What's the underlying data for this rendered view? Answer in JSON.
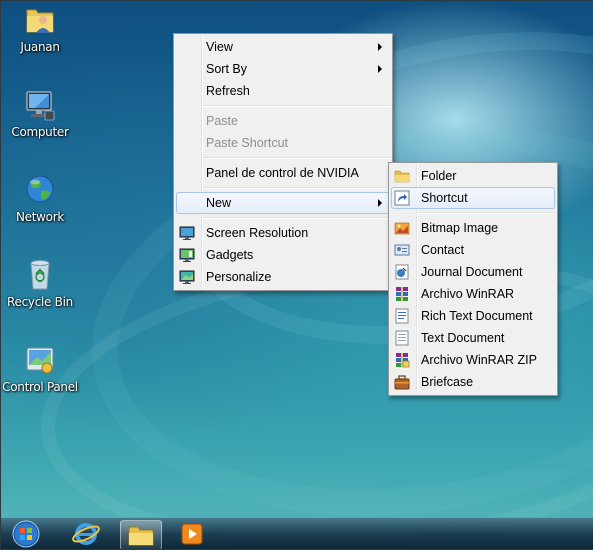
{
  "desktop": {
    "icons": [
      {
        "label": "Juanan",
        "icon": "user-folder-icon"
      },
      {
        "label": "Computer",
        "icon": "computer-icon"
      },
      {
        "label": "Network",
        "icon": "network-globe-icon"
      },
      {
        "label": "Recycle Bin",
        "icon": "recycle-bin-icon"
      },
      {
        "label": "Control Panel",
        "icon": "control-panel-icon"
      }
    ]
  },
  "context_menu": {
    "items": [
      {
        "label": "View",
        "submenu": true
      },
      {
        "label": "Sort By",
        "submenu": true
      },
      {
        "label": "Refresh"
      },
      {
        "label": "Paste",
        "disabled": true
      },
      {
        "label": "Paste Shortcut",
        "disabled": true
      },
      {
        "label": "Panel de control de NVIDIA"
      },
      {
        "label": "New",
        "submenu": true,
        "highlighted": true
      },
      {
        "label": "Screen Resolution",
        "icon": "monitor-icon"
      },
      {
        "label": "Gadgets",
        "icon": "gadgets-icon"
      },
      {
        "label": "Personalize",
        "icon": "personalize-icon"
      }
    ]
  },
  "new_submenu": {
    "items": [
      {
        "label": "Folder",
        "icon": "folder-icon"
      },
      {
        "label": "Shortcut",
        "icon": "shortcut-icon",
        "highlighted": true
      },
      {
        "label": "Bitmap Image",
        "icon": "bitmap-icon"
      },
      {
        "label": "Contact",
        "icon": "contact-card-icon"
      },
      {
        "label": "Journal Document",
        "icon": "journal-icon"
      },
      {
        "label": "Archivo WinRAR",
        "icon": "winrar-icon"
      },
      {
        "label": "Rich Text Document",
        "icon": "rtf-document-icon"
      },
      {
        "label": "Text Document",
        "icon": "text-document-icon"
      },
      {
        "label": "Archivo WinRAR ZIP",
        "icon": "winrar-zip-icon"
      },
      {
        "label": "Briefcase",
        "icon": "briefcase-icon"
      }
    ]
  },
  "taskbar": {
    "buttons": [
      {
        "name": "start-orb-icon"
      },
      {
        "name": "internet-explorer-icon"
      },
      {
        "name": "windows-explorer-icon"
      },
      {
        "name": "media-player-icon"
      }
    ]
  }
}
